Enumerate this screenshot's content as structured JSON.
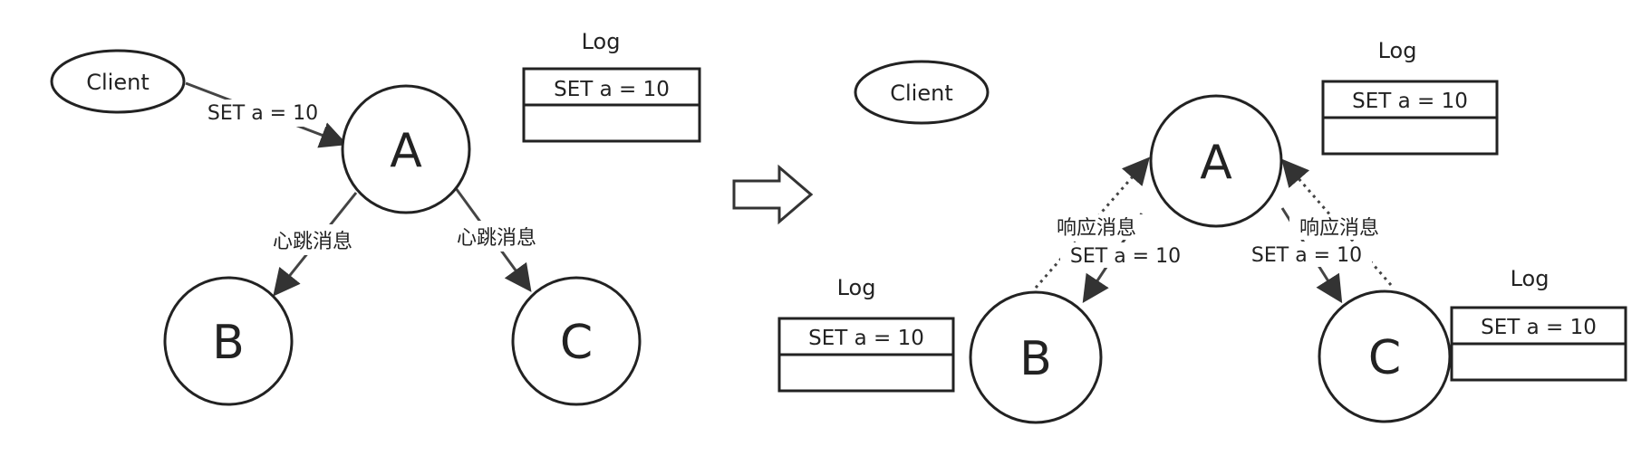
{
  "left_panel": {
    "client": {
      "label": "Client"
    },
    "request_label": "SET a = 10",
    "nodes": {
      "a": "A",
      "b": "B",
      "c": "C"
    },
    "heartbeat_label_b": "心跳消息",
    "heartbeat_label_c": "心跳消息",
    "log": {
      "title": "Log",
      "entries": [
        "SET a = 10",
        ""
      ]
    }
  },
  "transition_arrow": {
    "icon": "hollow-right-arrow-icon"
  },
  "right_panel": {
    "client": {
      "label": "Client"
    },
    "nodes": {
      "a": "A",
      "b": "B",
      "c": "C"
    },
    "edge_b": {
      "response": "响应消息",
      "command": "SET a = 10"
    },
    "edge_c": {
      "response": "响应消息",
      "command": "SET a = 10"
    },
    "log_a": {
      "title": "Log",
      "entries": [
        "SET a = 10",
        ""
      ]
    },
    "log_b": {
      "title": "Log",
      "entries": [
        "SET a = 10",
        ""
      ]
    },
    "log_c": {
      "title": "Log",
      "entries": [
        "SET a = 10",
        ""
      ]
    }
  },
  "colors": {
    "stroke": "#222222",
    "background": "#ffffff"
  }
}
